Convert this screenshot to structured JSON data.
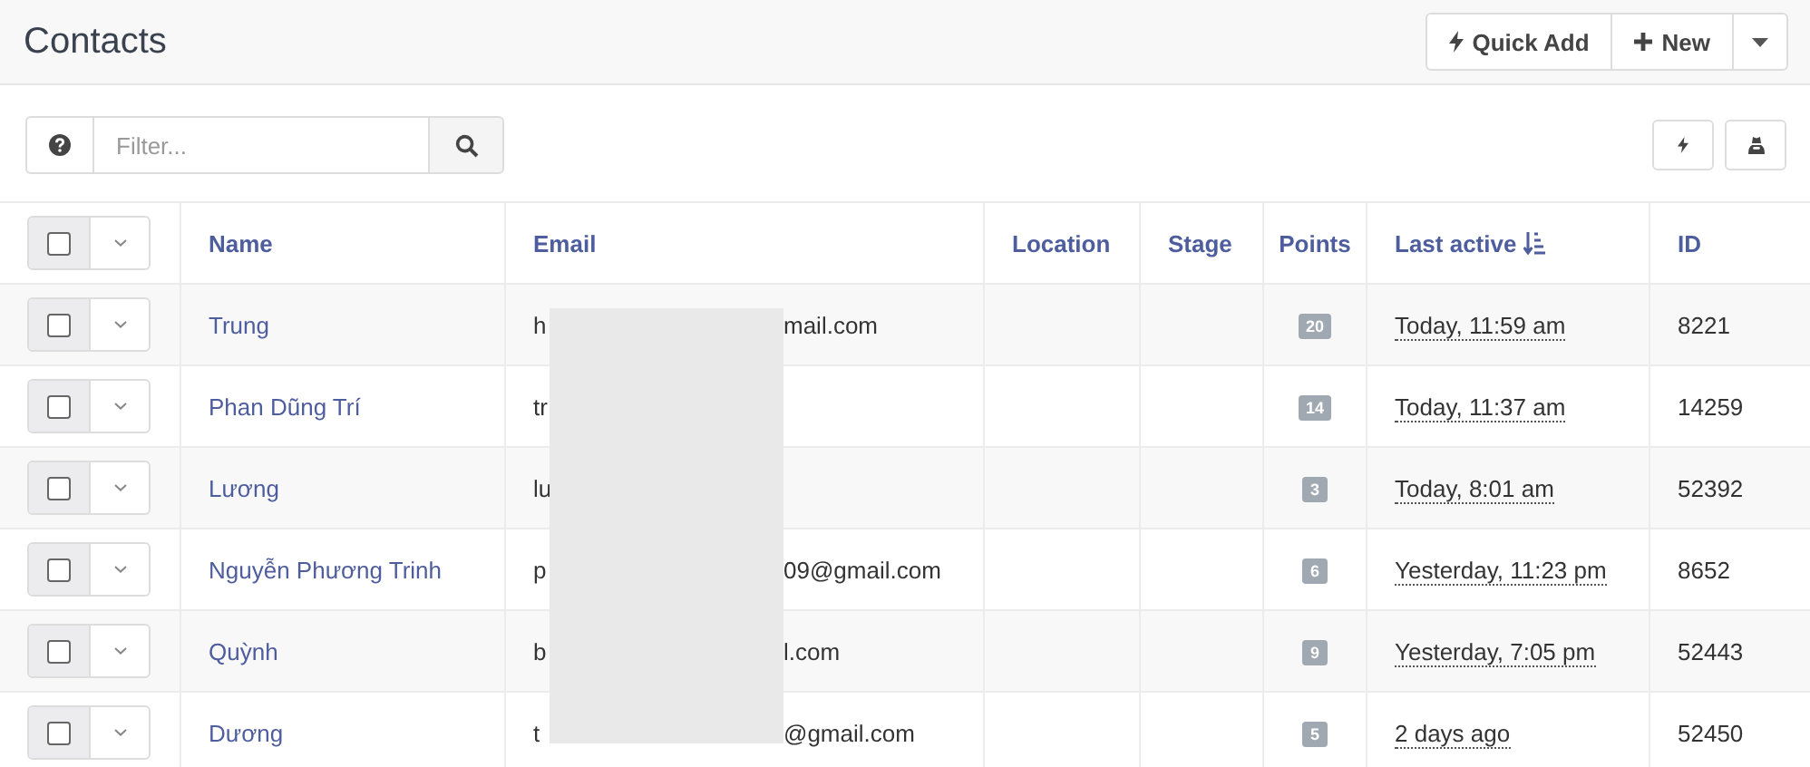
{
  "header": {
    "title": "Contacts",
    "buttons": [
      {
        "kind": "quick",
        "label": "Quick Add"
      },
      {
        "kind": "new",
        "label": "New"
      },
      {
        "kind": "caret"
      }
    ]
  },
  "filter": {
    "placeholder": "Filter..."
  },
  "table": {
    "select_all": {
      "checked": false
    },
    "columns": [
      {
        "label": "Name",
        "sorted": false
      },
      {
        "label": "Email",
        "sorted": false
      },
      {
        "label": "Location",
        "sorted": false
      },
      {
        "label": "Stage",
        "sorted": false
      },
      {
        "label": "Points",
        "sorted": false
      },
      {
        "label": "Last active",
        "sorted": true
      },
      {
        "label": "ID",
        "sorted": false
      }
    ],
    "rows": [
      {
        "checked": false,
        "name": "Trung",
        "email_start": "h",
        "email_end": "mail.com",
        "points": "20",
        "last_active": "Today, 11:59 am",
        "id": "8221"
      },
      {
        "checked": false,
        "name": "Phan Dũng Trí",
        "email_start": "tr",
        "points": "14",
        "last_active": "Today, 11:37 am",
        "id": "14259"
      },
      {
        "checked": false,
        "name": "Lương",
        "email_start": "lu",
        "points": "3",
        "last_active": "Today, 8:01 am",
        "id": "52392"
      },
      {
        "checked": false,
        "name": "Nguyễn Phương Trinh",
        "email_start": "p",
        "email_end": "09@gmail.com",
        "points": "6",
        "last_active": "Yesterday, 11:23 pm",
        "id": "8652"
      },
      {
        "checked": false,
        "name": "Quỳnh",
        "email_start": "b",
        "email_end": "l.com",
        "points": "9",
        "last_active": "Yesterday, 7:05 pm",
        "id": "52443"
      },
      {
        "checked": false,
        "name": "Dương",
        "email_start": "t",
        "email_end": "@gmail.com",
        "points": "5",
        "last_active": "2 days ago",
        "id": "52450"
      }
    ]
  }
}
